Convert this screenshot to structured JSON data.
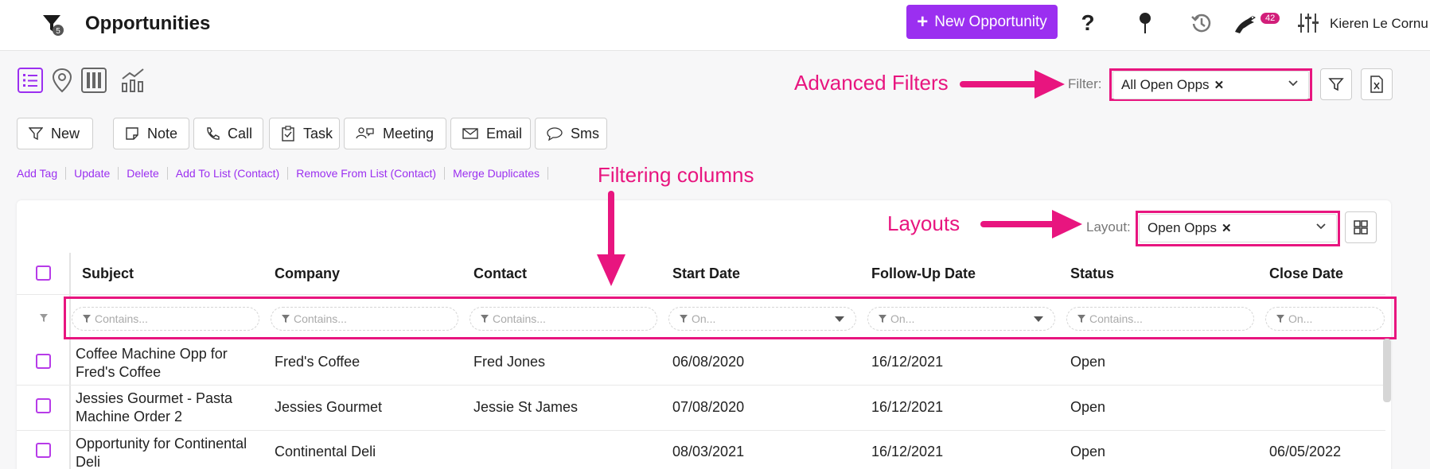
{
  "header": {
    "title": "Opportunities",
    "new_button": "New Opportunity",
    "help_glyph": "?",
    "notification_count": "42",
    "user_name": "Kieren Le Cornu",
    "app_badge": "5"
  },
  "filter": {
    "label": "Filter:",
    "value": "All Open Opps"
  },
  "layout": {
    "label": "Layout:",
    "value": "Open Opps"
  },
  "actions": [
    {
      "label": "New",
      "icon": "filter-icon"
    },
    {
      "label": "Note",
      "icon": "note-icon"
    },
    {
      "label": "Call",
      "icon": "phone-icon"
    },
    {
      "label": "Task",
      "icon": "task-icon"
    },
    {
      "label": "Meeting",
      "icon": "meeting-icon"
    },
    {
      "label": "Email",
      "icon": "email-icon"
    },
    {
      "label": "Sms",
      "icon": "sms-icon"
    }
  ],
  "bulk_links": [
    "Add Tag",
    "Update",
    "Delete",
    "Add To List (Contact)",
    "Remove From List (Contact)",
    "Merge Duplicates"
  ],
  "annotations": {
    "advanced_filters": "Advanced Filters",
    "filtering_columns": "Filtering columns",
    "layouts": "Layouts"
  },
  "table": {
    "columns": [
      "Subject",
      "Company",
      "Contact",
      "Start Date",
      "Follow-Up Date",
      "Status",
      "Close Date"
    ],
    "filter_placeholders": [
      "Contains...",
      "Contains...",
      "Contains...",
      "On...",
      "On...",
      "Contains...",
      "On..."
    ],
    "rows": [
      {
        "subject": "Coffee Machine Opp for Fred's Coffee",
        "company": "Fred's Coffee",
        "contact": "Fred Jones",
        "start": "06/08/2020",
        "followup": "16/12/2021",
        "status": "Open",
        "close": ""
      },
      {
        "subject": "Jessies Gourmet - Pasta Machine Order 2",
        "company": "Jessies Gourmet",
        "contact": "Jessie St James",
        "start": "07/08/2020",
        "followup": "16/12/2021",
        "status": "Open",
        "close": ""
      },
      {
        "subject": "Opportunity for Continental Deli",
        "company": "Continental Deli",
        "contact": "",
        "start": "08/03/2021",
        "followup": "16/12/2021",
        "status": "Open",
        "close": "06/05/2022"
      }
    ]
  },
  "colors": {
    "accent": "#9b2ff0",
    "annotation": "#e8157f",
    "badge": "#d21e7a"
  }
}
